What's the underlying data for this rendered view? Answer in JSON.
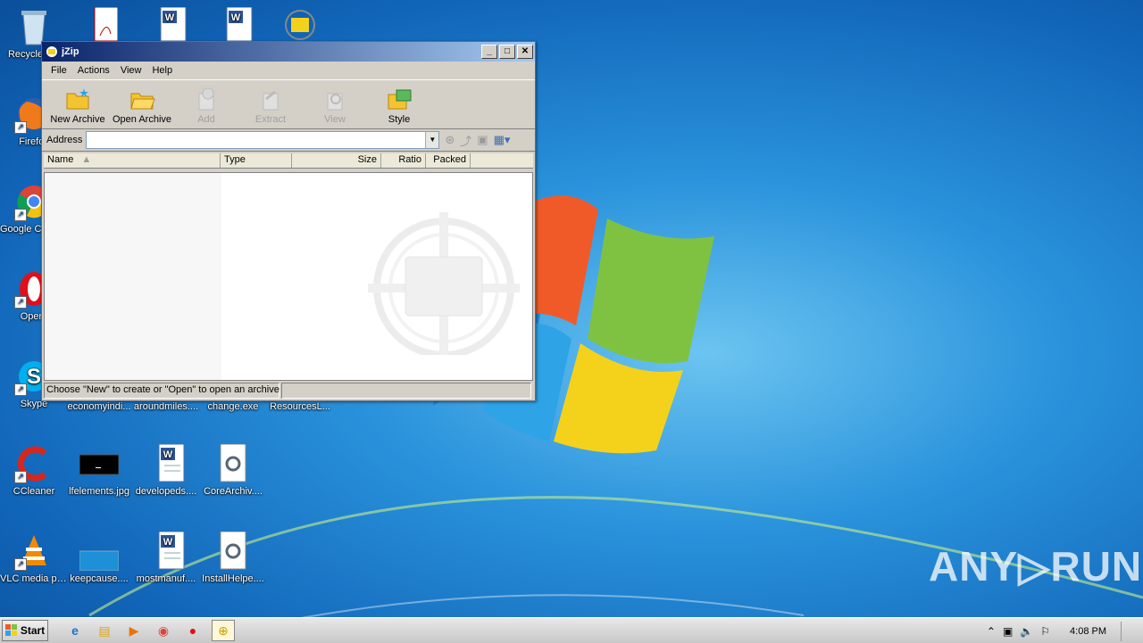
{
  "desktop": {
    "icons": [
      {
        "label": "Recycle Bin",
        "icon": "recycle-bin-icon"
      },
      {
        "label": "Firefox",
        "icon": "firefox-icon"
      },
      {
        "label": "Google Chrome",
        "icon": "chrome-icon"
      },
      {
        "label": "Opera",
        "icon": "opera-icon"
      },
      {
        "label": "Skype",
        "icon": "skype-icon"
      },
      {
        "label": "CCleaner",
        "icon": "ccleaner-icon"
      },
      {
        "label": "VLC media player",
        "icon": "vlc-icon"
      },
      {
        "label": "economyindi...",
        "icon": "file-icon"
      },
      {
        "label": "aroundmiles....",
        "icon": "file-icon"
      },
      {
        "label": "change.exe",
        "icon": "exe-icon"
      },
      {
        "label": "ResourcesL...",
        "icon": "file-icon"
      },
      {
        "label": "lfelements.jpg",
        "icon": "image-icon"
      },
      {
        "label": "developeds....",
        "icon": "word-doc-icon"
      },
      {
        "label": "CoreArchiv....",
        "icon": "settings-file-icon"
      },
      {
        "label": "keepcause....",
        "icon": "image-icon"
      },
      {
        "label": "mostmanuf....",
        "icon": "word-doc-icon"
      },
      {
        "label": "InstallHelpe....",
        "icon": "settings-file-icon"
      }
    ],
    "watermark": "ANY▷RUN"
  },
  "window": {
    "title": "jZip",
    "menu": [
      "File",
      "Actions",
      "View",
      "Help"
    ],
    "toolbar": [
      {
        "label": "New Archive",
        "enabled": true
      },
      {
        "label": "Open Archive",
        "enabled": true
      },
      {
        "label": "Add",
        "enabled": false
      },
      {
        "label": "Extract",
        "enabled": false
      },
      {
        "label": "View",
        "enabled": false
      },
      {
        "label": "Style",
        "enabled": true
      }
    ],
    "address_label": "Address",
    "address_value": "",
    "columns": [
      "Name",
      "Type",
      "Size",
      "Ratio",
      "Packed"
    ],
    "status": "Choose \"New\" to create or \"Open\" to open an archive"
  },
  "taskbar": {
    "start_label": "Start",
    "clock": "4:08 PM"
  },
  "colors": {
    "title_gradient_start": "#0a246a",
    "desktop_blue": "#1e7fd0"
  }
}
